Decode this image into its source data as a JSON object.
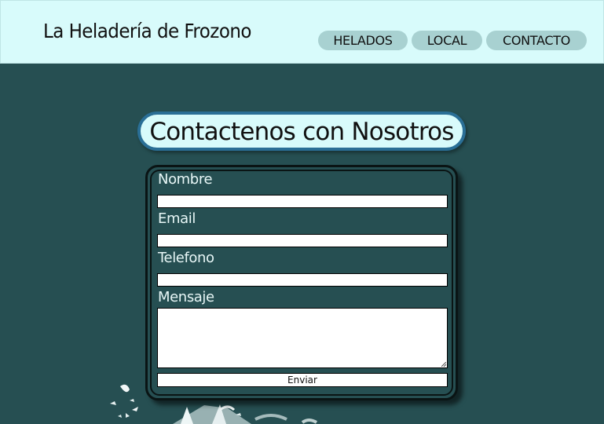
{
  "header": {
    "brand": "La Heladería de Frozono",
    "nav": [
      {
        "label": "HELADOS"
      },
      {
        "label": "LOCAL"
      },
      {
        "label": "CONTACTO"
      }
    ]
  },
  "main": {
    "title": "Contactenos con Nosotros"
  },
  "form": {
    "fields": [
      {
        "label": "Nombre",
        "value": ""
      },
      {
        "label": "Email",
        "value": ""
      },
      {
        "label": "Telefono",
        "value": ""
      },
      {
        "label": "Mensaje",
        "value": ""
      }
    ],
    "submit_label": "Enviar"
  },
  "colors": {
    "page_background": "#264f52",
    "header_background": "#d8fbfb",
    "nav_pill": "#a8d1d1",
    "title_border": "#2a6f96"
  }
}
